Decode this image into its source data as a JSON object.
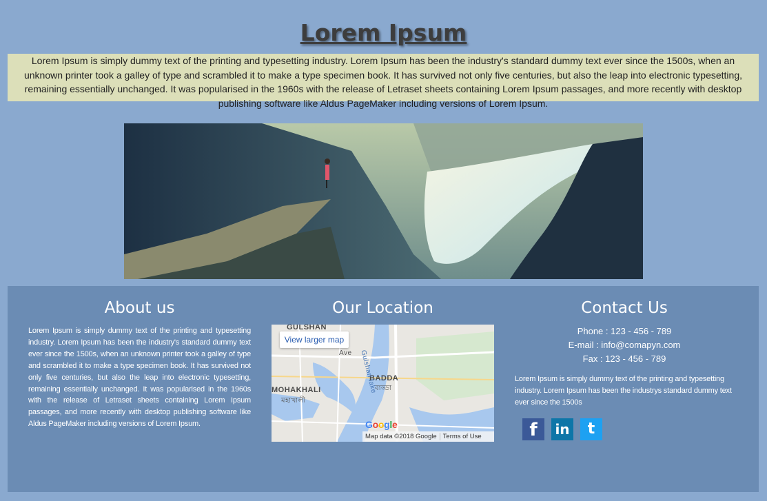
{
  "header": {
    "title": "Lorem Ipsum",
    "intro": "Lorem Ipsum is simply dummy text of the printing and typesetting industry. Lorem Ipsum has been the industry's standard dummy text ever since the 1500s, when an unknown printer took a galley of type and scrambled it to make a type specimen book. It has survived not only five centuries, but also the leap into electronic typesetting, remaining essentially unchanged. It was popularised in the 1960s with the release of Letraset sheets containing Lorem Ipsum passages, and more recently with desktop publishing software like Aldus PageMaker including versions of Lorem Ipsum."
  },
  "hero": {
    "icon": "landscape-photo"
  },
  "footer": {
    "about": {
      "heading": "About us",
      "text": "Lorem Ipsum is simply dummy text of the printing and typesetting industry. Lorem Ipsum has been the industry's standard dummy text ever since the 1500s, when an unknown printer took a galley of type and scrambled it to make a type specimen book. It has survived not only five centuries, but also the leap into electronic typesetting, remaining essentially unchanged. It was popularised in the 1960s with the release of Letraset sheets containing Lorem Ipsum passages, and more recently with desktop publishing software like Aldus PageMaker including versions of Lorem Ipsum."
    },
    "location": {
      "heading": "Our Location",
      "map_button": "View larger map",
      "labels": {
        "gulshan": "GULSHAN",
        "badda": "BADDA",
        "badda_bn": "বাড্ডা",
        "mohakhali": "MOHAKHALI",
        "mohakhali_bn": "মহাখালী",
        "lake": "Gulshan lake",
        "avenue": "Ave"
      },
      "google": "Google",
      "map_data": "Map data ©2018 Google",
      "terms": "Terms of Use"
    },
    "contact": {
      "heading": "Contact Us",
      "phone": "Phone : 123 - 456 - 789",
      "email": "E-mail : info@comapyn.com",
      "fax": "Fax : 123 - 456 - 789",
      "text": "Lorem Ipsum is simply dummy text of the printing and typesetting industry. Lorem Ipsum has been the industrys standard dummy text ever since the 1500s",
      "social": [
        {
          "name": "facebook",
          "glyph": "f",
          "color": "#3b5998"
        },
        {
          "name": "linkedin",
          "glyph": "in",
          "color": "#0e76a8"
        },
        {
          "name": "twitter",
          "glyph": "t",
          "color": "#1da1f2"
        }
      ]
    }
  }
}
